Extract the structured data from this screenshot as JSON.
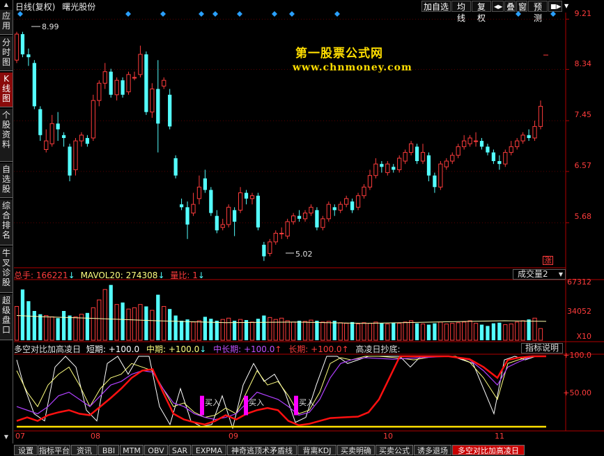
{
  "header": {
    "chart_type": "日线(复权)",
    "stock_name": "曙光股份",
    "toolbar": [
      "加自选",
      "均线",
      "复权",
      "◀▶",
      "叠",
      "窗",
      "预测",
      "■▶",
      "▼"
    ]
  },
  "sidebar": {
    "items": [
      {
        "label": "应用"
      },
      {
        "label": "分时图"
      },
      {
        "label": "K线图"
      },
      {
        "label": "个股资料"
      },
      {
        "label": "自选股"
      },
      {
        "label": "综合排名"
      },
      {
        "label": "牛叉诊股"
      },
      {
        "label": "超级盘口"
      }
    ]
  },
  "watermark": {
    "title": "第一股票公式网",
    "url": "www.chnmoney.com"
  },
  "price_axis": [
    "9.21",
    "8.34",
    "7.45",
    "6.57",
    "5.68"
  ],
  "high_label": "8.99",
  "low_label": "5.02",
  "zhang_label": "涨",
  "volume_panel": {
    "total_label": "总手: ",
    "total_value": "166221",
    "ma_label": "MAVOL20: ",
    "ma_value": "274308",
    "ratio_label": "量比: ",
    "ratio_value": "1",
    "selector": "成交量2",
    "axis": [
      "67312",
      "34052",
      "X10"
    ]
  },
  "indicator_panel": {
    "name": "多空对比加高凌日",
    "short_label": "短期: ",
    "short_value": "+100.0",
    "mid_label": "中期: ",
    "mid_value": "+100.0",
    "midlong_label": "中长期: ",
    "midlong_value": "+100.0",
    "long_label": "长期: ",
    "long_value": "+100.0",
    "bottom_label": "高凌日抄底:",
    "help_button": "指标说明",
    "axis": [
      "+100.0",
      "+50.00"
    ],
    "buy_label": "买入"
  },
  "x_axis": [
    "07",
    "08",
    "09",
    "10",
    "11"
  ],
  "bottom_tabs": [
    "设置",
    "指标平台",
    "资讯",
    "BBI",
    "MTM",
    "OBV",
    "SAR",
    "EXPMA",
    "神奇逃顶术矛盾线",
    "背离KDJ",
    "买卖明确",
    "买卖公式",
    "诱多退场",
    "多空对比加高凌日"
  ],
  "colors": {
    "up": "#ff3c3c",
    "down": "#54ffff",
    "short_line": "#ffffff",
    "mid_line": "#ffff80",
    "midlong_line": "#b040ff",
    "long_line": "#ff1010",
    "bottom_line": "#ffe000",
    "buy_bar": "#ff00ff",
    "diamond": "#2aa0ff"
  },
  "chart_data": {
    "type": "candlestick",
    "price_range": [
      4.95,
      9.3
    ],
    "high": 8.99,
    "low": 5.02,
    "candles": [
      [
        8.5,
        8.95,
        8.45,
        8.99
      ],
      [
        8.95,
        8.6,
        8.55,
        8.99
      ],
      [
        8.6,
        8.55,
        8.4,
        8.7
      ],
      [
        8.45,
        7.7,
        7.65,
        8.5
      ],
      [
        7.65,
        7.2,
        7.1,
        7.7
      ],
      [
        6.95,
        7.1,
        6.9,
        7.3
      ],
      [
        7.05,
        7.4,
        7.0,
        7.55
      ],
      [
        7.4,
        7.3,
        7.1,
        7.6
      ],
      [
        7.2,
        7.15,
        7.0,
        7.25
      ],
      [
        7.0,
        6.5,
        6.4,
        7.05
      ],
      [
        6.6,
        7.1,
        6.5,
        7.15
      ],
      [
        7.1,
        7.2,
        7.0,
        7.25
      ],
      [
        7.15,
        7.05,
        7.0,
        7.2
      ],
      [
        7.15,
        7.8,
        7.1,
        7.9
      ],
      [
        7.8,
        8.1,
        7.7,
        8.15
      ],
      [
        8.1,
        8.3,
        8.0,
        8.45
      ],
      [
        8.3,
        7.9,
        7.85,
        8.35
      ],
      [
        7.9,
        8.15,
        7.8,
        8.2
      ],
      [
        8.15,
        7.9,
        7.85,
        8.2
      ],
      [
        7.95,
        8.25,
        7.9,
        8.3
      ],
      [
        8.2,
        8.2,
        8.15,
        8.3
      ],
      [
        8.25,
        8.6,
        8.2,
        8.75
      ],
      [
        8.6,
        7.6,
        7.55,
        8.65
      ],
      [
        7.6,
        8.0,
        7.5,
        8.1
      ],
      [
        8.0,
        7.4,
        6.9,
        8.5
      ],
      [
        8.05,
        8.15,
        8.0,
        8.2
      ],
      [
        7.9,
        7.35,
        7.3,
        8.0
      ],
      [
        6.8,
        6.5,
        6.45,
        6.85
      ],
      [
        6.0,
        5.95,
        5.9,
        6.1
      ],
      [
        5.95,
        5.65,
        5.4,
        6.05
      ],
      [
        5.85,
        6.0,
        5.8,
        6.2
      ],
      [
        6.1,
        6.3,
        6.0,
        6.5
      ],
      [
        6.45,
        6.25,
        6.2,
        6.6
      ],
      [
        6.25,
        5.85,
        5.8,
        6.3
      ],
      [
        5.8,
        5.55,
        5.5,
        5.9
      ],
      [
        5.6,
        5.65,
        5.55,
        5.75
      ],
      [
        5.65,
        5.95,
        5.6,
        6.0
      ],
      [
        5.9,
        5.7,
        5.45,
        5.95
      ],
      [
        5.9,
        6.2,
        5.85,
        6.3
      ],
      [
        6.2,
        6.1,
        6.0,
        6.25
      ],
      [
        6.1,
        6.15,
        6.0,
        6.2
      ],
      [
        6.15,
        5.6,
        5.55,
        6.2
      ],
      [
        5.3,
        5.1,
        5.02,
        5.35
      ],
      [
        5.15,
        5.35,
        5.1,
        5.4
      ],
      [
        5.35,
        5.5,
        5.3,
        5.55
      ],
      [
        5.5,
        5.5,
        5.4,
        5.6
      ],
      [
        5.45,
        5.7,
        5.4,
        5.75
      ],
      [
        5.7,
        5.8,
        5.65,
        5.85
      ],
      [
        5.8,
        5.75,
        5.7,
        5.9
      ],
      [
        5.75,
        5.85,
        5.7,
        5.9
      ],
      [
        5.85,
        5.95,
        5.8,
        6.0
      ],
      [
        5.9,
        5.6,
        5.55,
        5.95
      ],
      [
        5.6,
        5.75,
        5.55,
        5.8
      ],
      [
        5.75,
        6.0,
        5.7,
        6.05
      ],
      [
        5.95,
        5.9,
        5.8,
        6.0
      ],
      [
        5.9,
        6.0,
        5.85,
        6.05
      ],
      [
        6.0,
        6.1,
        5.95,
        6.15
      ],
      [
        6.05,
        5.9,
        5.85,
        6.1
      ],
      [
        5.95,
        6.15,
        5.9,
        6.2
      ],
      [
        6.15,
        6.3,
        6.1,
        6.35
      ],
      [
        6.3,
        6.5,
        6.25,
        6.6
      ],
      [
        6.5,
        6.7,
        6.45,
        6.8
      ],
      [
        6.7,
        6.65,
        6.55,
        6.75
      ],
      [
        6.55,
        6.7,
        6.5,
        6.75
      ],
      [
        6.65,
        6.6,
        6.55,
        6.7
      ],
      [
        6.6,
        6.8,
        6.55,
        6.85
      ],
      [
        6.75,
        6.9,
        6.7,
        6.95
      ],
      [
        6.9,
        7.05,
        6.85,
        7.1
      ],
      [
        7.0,
        6.75,
        6.7,
        7.05
      ],
      [
        6.75,
        6.9,
        6.7,
        7.05
      ],
      [
        6.85,
        6.5,
        6.4,
        6.9
      ],
      [
        6.5,
        6.3,
        6.2,
        6.55
      ],
      [
        6.3,
        6.7,
        6.25,
        6.75
      ],
      [
        6.65,
        6.75,
        6.6,
        6.8
      ],
      [
        6.75,
        6.85,
        6.7,
        6.9
      ],
      [
        6.85,
        7.0,
        6.8,
        7.05
      ],
      [
        7.0,
        7.1,
        6.95,
        7.2
      ],
      [
        7.05,
        7.15,
        7.0,
        7.2
      ],
      [
        7.1,
        7.1,
        7.0,
        7.25
      ],
      [
        7.1,
        7.0,
        6.95,
        7.15
      ],
      [
        7.0,
        6.9,
        6.85,
        7.05
      ],
      [
        6.9,
        6.75,
        6.7,
        6.95
      ],
      [
        6.75,
        6.7,
        6.6,
        6.85
      ],
      [
        6.7,
        6.9,
        6.65,
        6.95
      ],
      [
        6.9,
        7.0,
        6.85,
        7.1
      ],
      [
        7.0,
        7.1,
        6.95,
        7.15
      ],
      [
        7.1,
        7.2,
        7.05,
        7.25
      ],
      [
        7.2,
        7.15,
        7.1,
        7.3
      ],
      [
        7.15,
        7.35,
        7.1,
        7.45
      ],
      [
        7.35,
        7.7,
        7.3,
        7.8
      ]
    ],
    "volumes": [
      52,
      78,
      60,
      45,
      40,
      38,
      36,
      34,
      45,
      38,
      36,
      40,
      42,
      50,
      62,
      78,
      85,
      55,
      58,
      48,
      50,
      55,
      52,
      46,
      70,
      52,
      48,
      38,
      30,
      32,
      28,
      30,
      36,
      33,
      30,
      32,
      34,
      30,
      32,
      31,
      28,
      33,
      38,
      35,
      32,
      34,
      30,
      28,
      30,
      29,
      31,
      30,
      28,
      29,
      30,
      27,
      26,
      28,
      25,
      27,
      26,
      28,
      26,
      25,
      27,
      26,
      28,
      30,
      26,
      25,
      24,
      26,
      28,
      25,
      26,
      27,
      28,
      30,
      26,
      24,
      22,
      26,
      27,
      24,
      25,
      28,
      30,
      32,
      34,
      18
    ],
    "vol_ma": [
      [
        0,
        38
      ],
      [
        40,
        36
      ],
      [
        100,
        34
      ],
      [
        200,
        30
      ],
      [
        300,
        27
      ],
      [
        400,
        28
      ],
      [
        500,
        26
      ],
      [
        600,
        28
      ],
      [
        700,
        30
      ],
      [
        760,
        29
      ]
    ],
    "indicator": {
      "short": [
        [
          0,
          95
        ],
        [
          10,
          60
        ],
        [
          25,
          20
        ],
        [
          40,
          10
        ],
        [
          55,
          85
        ],
        [
          70,
          100
        ],
        [
          85,
          85
        ],
        [
          100,
          25
        ],
        [
          115,
          10
        ],
        [
          130,
          90
        ],
        [
          145,
          100
        ],
        [
          160,
          75
        ],
        [
          175,
          100
        ],
        [
          190,
          100
        ],
        [
          205,
          30
        ],
        [
          220,
          5
        ],
        [
          235,
          55
        ],
        [
          250,
          10
        ],
        [
          265,
          2
        ],
        [
          280,
          5
        ],
        [
          295,
          45
        ],
        [
          310,
          0
        ],
        [
          325,
          60
        ],
        [
          340,
          90
        ],
        [
          355,
          65
        ],
        [
          370,
          75
        ],
        [
          385,
          50
        ],
        [
          400,
          8
        ],
        [
          415,
          15
        ],
        [
          430,
          60
        ],
        [
          445,
          100
        ],
        [
          460,
          100
        ],
        [
          475,
          90
        ],
        [
          490,
          95
        ],
        [
          505,
          100
        ],
        [
          520,
          100
        ],
        [
          535,
          100
        ],
        [
          550,
          100
        ],
        [
          565,
          85
        ],
        [
          580,
          100
        ],
        [
          595,
          100
        ],
        [
          610,
          100
        ],
        [
          625,
          100
        ],
        [
          640,
          95
        ],
        [
          655,
          90
        ],
        [
          670,
          55
        ],
        [
          685,
          20
        ],
        [
          700,
          95
        ],
        [
          715,
          100
        ],
        [
          730,
          95
        ],
        [
          745,
          100
        ],
        [
          760,
          100
        ]
      ],
      "mid": [
        [
          0,
          80
        ],
        [
          15,
          50
        ],
        [
          30,
          30
        ],
        [
          45,
          60
        ],
        [
          60,
          75
        ],
        [
          75,
          85
        ],
        [
          90,
          60
        ],
        [
          105,
          30
        ],
        [
          120,
          55
        ],
        [
          135,
          70
        ],
        [
          150,
          75
        ],
        [
          165,
          90
        ],
        [
          180,
          85
        ],
        [
          195,
          80
        ],
        [
          210,
          55
        ],
        [
          225,
          30
        ],
        [
          240,
          35
        ],
        [
          255,
          22
        ],
        [
          270,
          15
        ],
        [
          285,
          18
        ],
        [
          300,
          28
        ],
        [
          315,
          20
        ],
        [
          330,
          50
        ],
        [
          345,
          80
        ],
        [
          360,
          60
        ],
        [
          375,
          65
        ],
        [
          390,
          45
        ],
        [
          405,
          20
        ],
        [
          420,
          25
        ],
        [
          435,
          50
        ],
        [
          450,
          90
        ],
        [
          465,
          98
        ],
        [
          480,
          95
        ],
        [
          500,
          100
        ],
        [
          520,
          100
        ],
        [
          545,
          98
        ],
        [
          570,
          95
        ],
        [
          600,
          100
        ],
        [
          630,
          100
        ],
        [
          650,
          92
        ],
        [
          670,
          70
        ],
        [
          690,
          40
        ],
        [
          705,
          90
        ],
        [
          720,
          95
        ],
        [
          740,
          100
        ],
        [
          760,
          100
        ]
      ],
      "midlong": [
        [
          0,
          30
        ],
        [
          15,
          25
        ],
        [
          30,
          20
        ],
        [
          45,
          30
        ],
        [
          60,
          45
        ],
        [
          75,
          50
        ],
        [
          90,
          40
        ],
        [
          105,
          30
        ],
        [
          120,
          45
        ],
        [
          135,
          60
        ],
        [
          150,
          65
        ],
        [
          165,
          75
        ],
        [
          180,
          80
        ],
        [
          195,
          78
        ],
        [
          210,
          55
        ],
        [
          225,
          35
        ],
        [
          240,
          30
        ],
        [
          255,
          20
        ],
        [
          270,
          15
        ],
        [
          285,
          12
        ],
        [
          300,
          15
        ],
        [
          315,
          20
        ],
        [
          330,
          35
        ],
        [
          345,
          50
        ],
        [
          360,
          45
        ],
        [
          375,
          40
        ],
        [
          390,
          30
        ],
        [
          405,
          18
        ],
        [
          420,
          22
        ],
        [
          435,
          40
        ],
        [
          450,
          70
        ],
        [
          465,
          90
        ],
        [
          480,
          95
        ],
        [
          500,
          98
        ],
        [
          540,
          96
        ],
        [
          580,
          98
        ],
        [
          620,
          100
        ],
        [
          650,
          95
        ],
        [
          670,
          80
        ],
        [
          690,
          60
        ],
        [
          705,
          85
        ],
        [
          720,
          92
        ],
        [
          740,
          100
        ],
        [
          760,
          100
        ]
      ],
      "long": [
        [
          0,
          10
        ],
        [
          15,
          15
        ],
        [
          30,
          10
        ],
        [
          45,
          18
        ],
        [
          60,
          22
        ],
        [
          75,
          25
        ],
        [
          90,
          20
        ],
        [
          105,
          18
        ],
        [
          120,
          30
        ],
        [
          135,
          42
        ],
        [
          150,
          55
        ],
        [
          165,
          70
        ],
        [
          180,
          80
        ],
        [
          195,
          82
        ],
        [
          210,
          50
        ],
        [
          225,
          20
        ],
        [
          240,
          12
        ],
        [
          255,
          8
        ],
        [
          270,
          5
        ],
        [
          285,
          10
        ],
        [
          300,
          18
        ],
        [
          315,
          12
        ],
        [
          330,
          20
        ],
        [
          345,
          25
        ],
        [
          360,
          28
        ],
        [
          375,
          25
        ],
        [
          390,
          10
        ],
        [
          405,
          4
        ],
        [
          420,
          6
        ],
        [
          435,
          10
        ],
        [
          450,
          14
        ],
        [
          470,
          15
        ],
        [
          490,
          16
        ],
        [
          505,
          22
        ],
        [
          520,
          40
        ],
        [
          535,
          70
        ],
        [
          550,
          100
        ],
        [
          580,
          100
        ],
        [
          620,
          100
        ],
        [
          650,
          96
        ],
        [
          670,
          85
        ],
        [
          690,
          70
        ],
        [
          705,
          95
        ],
        [
          720,
          98
        ],
        [
          740,
          100
        ],
        [
          760,
          100
        ]
      ],
      "bottom": [
        [
          0,
          2
        ],
        [
          760,
          2
        ]
      ],
      "buy_signals": [
        [
          265,
          5
        ],
        [
          328,
          5
        ],
        [
          400,
          5
        ]
      ]
    },
    "diamonds": [
      5,
      160,
      210,
      265,
      285,
      320,
      370,
      395,
      460,
      720,
      770
    ]
  }
}
